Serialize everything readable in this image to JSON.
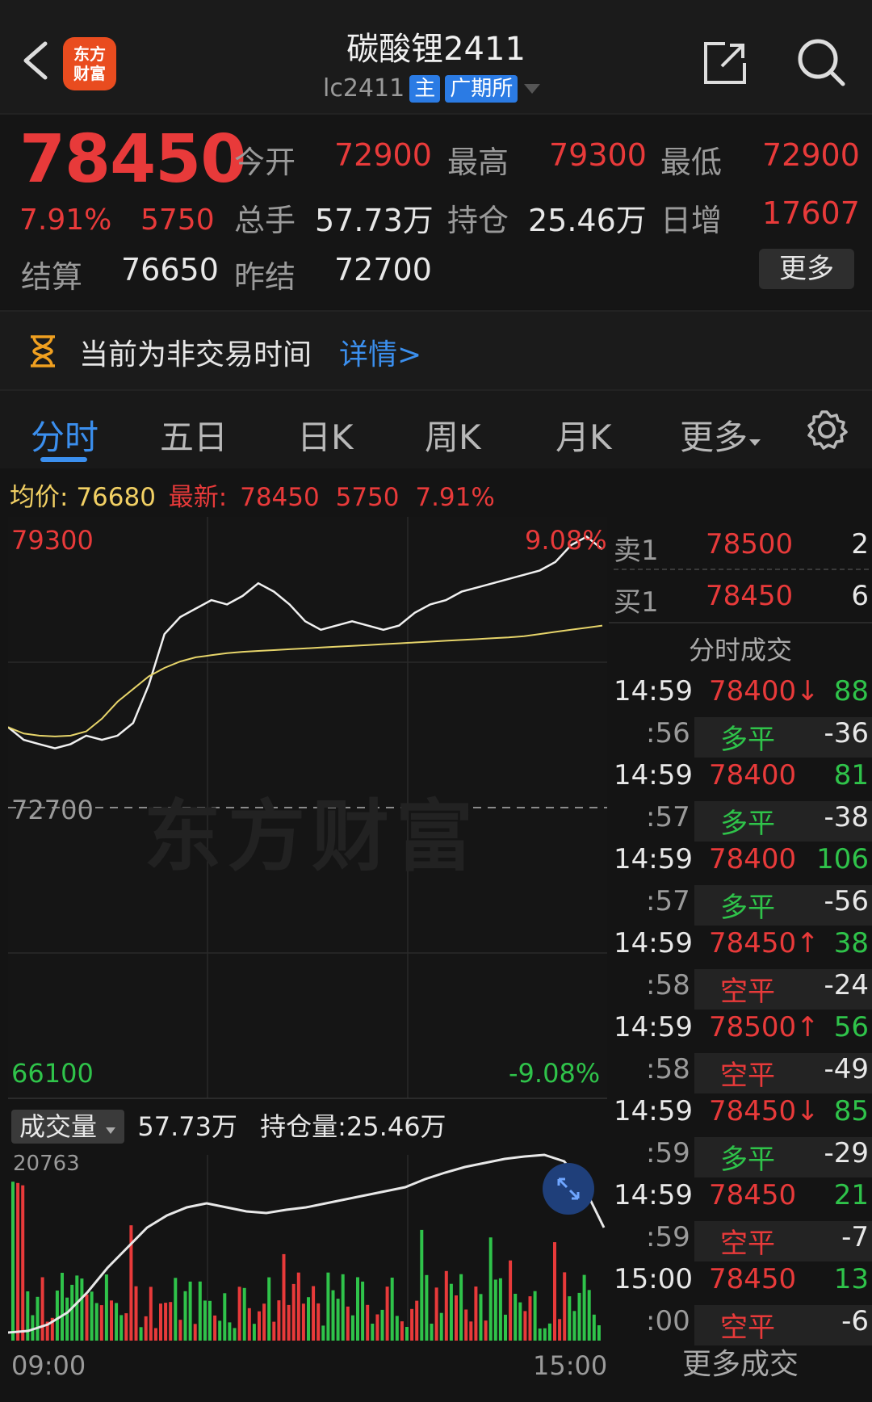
{
  "header": {
    "title": "碳酸锂2411",
    "code": "lc2411",
    "tag_main": "主",
    "tag_exchange": "广期所",
    "logo_line1": "东方",
    "logo_line2": "财富"
  },
  "quote": {
    "last": "78450",
    "change_pct": "7.91%",
    "change": "5750",
    "open_label": "今开",
    "open": "72900",
    "high_label": "最高",
    "high": "79300",
    "low_label": "最低",
    "low": "72900",
    "volume_label": "总手",
    "volume": "57.73万",
    "oi_label": "持仓",
    "oi": "25.46万",
    "oi_change_label": "日增",
    "oi_change": "17607",
    "settle_label": "结算",
    "settle": "76650",
    "prev_settle_label": "昨结",
    "prev_settle": "72700",
    "more_label": "更多"
  },
  "notice": {
    "text": "当前为非交易时间",
    "link": "详情>"
  },
  "tabs": [
    "分时",
    "五日",
    "日K",
    "周K",
    "月K",
    "更多"
  ],
  "stats": {
    "avg_label": "均价:",
    "avg": "76680",
    "latest_label": "最新:",
    "latest": "78450",
    "change": "5750",
    "pct": "7.91%"
  },
  "chart": {
    "y_max": "79300",
    "y_max_pct": "9.08%",
    "y_mid": "72700",
    "y_min": "66100",
    "y_min_pct": "-9.08%",
    "watermark": "东方财富",
    "vol_select_label": "成交量",
    "vol_total": "57.73万",
    "oi_label": "持仓量:25.46万",
    "vol_max": "20763",
    "x_start": "09:00",
    "x_end": "15:00"
  },
  "chart_data": {
    "type": "line",
    "ylim": [
      66100,
      79300
    ],
    "series": [
      {
        "values": [
          74600,
          74300,
          74200,
          74100,
          74200,
          74400,
          74300,
          74400,
          74700,
          75600,
          76800,
          77200,
          77400,
          77600,
          77500,
          77700,
          78000,
          77800,
          77500,
          77100,
          76900,
          77000,
          77100,
          77000,
          76900,
          77000,
          77300,
          77500,
          77600,
          77800,
          77900,
          78000,
          78100,
          78200,
          78300,
          78500,
          78900,
          79100,
          78800
        ]
      },
      {
        "values": [
          74600,
          74450,
          74400,
          74380,
          74400,
          74500,
          74800,
          75200,
          75500,
          75800,
          76000,
          76150,
          76250,
          76300,
          76350,
          76380,
          76400,
          76420,
          76440,
          76460,
          76480,
          76500,
          76520,
          76540,
          76560,
          76580,
          76600,
          76620,
          76640,
          76660,
          76680,
          76700,
          76720,
          76750,
          76800,
          76850,
          76900,
          76950,
          77000
        ]
      }
    ]
  },
  "book": {
    "ask_label": "卖1",
    "ask_price": "78500",
    "ask_vol": "2",
    "bid_label": "买1",
    "bid_price": "78450",
    "bid_vol": "6",
    "ticks_title": "分时成交",
    "more_ticks": "更多成交"
  },
  "ticks": [
    {
      "time": "14:59",
      "price": "78400↓",
      "vol": "88",
      "sub_time": ":56",
      "type": "多平",
      "oi": "-36"
    },
    {
      "time": "14:59",
      "price": "78400",
      "vol": "81",
      "sub_time": ":57",
      "type": "多平",
      "oi": "-38"
    },
    {
      "time": "14:59",
      "price": "78400",
      "vol": "106",
      "sub_time": ":57",
      "type": "多平",
      "oi": "-56"
    },
    {
      "time": "14:59",
      "price": "78450↑",
      "vol": "38",
      "sub_time": ":58",
      "type": "空平",
      "oi": "-24"
    },
    {
      "time": "14:59",
      "price": "78500↑",
      "vol": "56",
      "sub_time": ":58",
      "type": "空平",
      "oi": "-49"
    },
    {
      "time": "14:59",
      "price": "78450↓",
      "vol": "85",
      "sub_time": ":59",
      "type": "多平",
      "oi": "-29"
    },
    {
      "time": "14:59",
      "price": "78450",
      "vol": "21",
      "sub_time": ":59",
      "type": "空平",
      "oi": "-7"
    },
    {
      "time": "15:00",
      "price": "78450",
      "vol": "13",
      "sub_time": ":00",
      "type": "空平",
      "oi": "-6"
    }
  ]
}
